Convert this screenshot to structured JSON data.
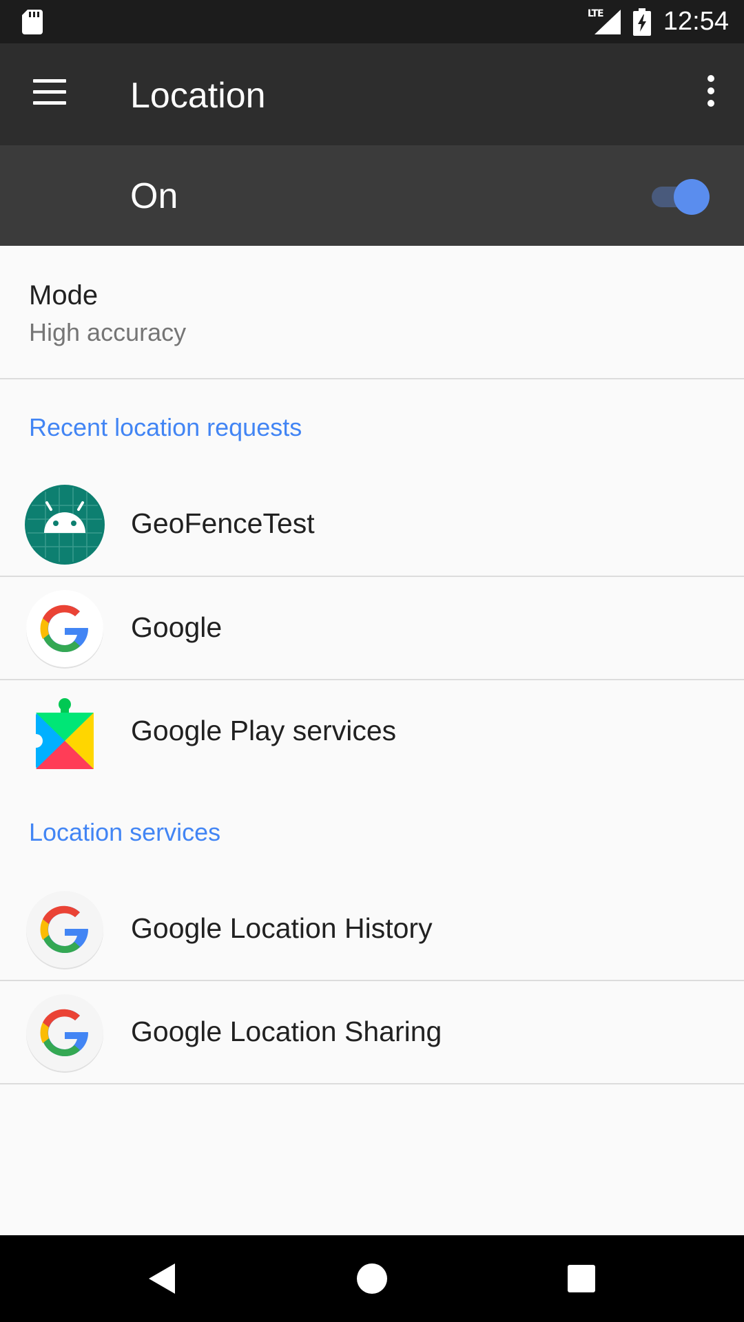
{
  "status_bar": {
    "network_type": "LTE",
    "time": "12:54"
  },
  "app_bar": {
    "title": "Location",
    "menu_icon": "hamburger-menu-icon",
    "overflow_icon": "more-vert-icon"
  },
  "master_switch": {
    "label": "On",
    "checked": true,
    "accent_color": "#5a8dee"
  },
  "mode": {
    "title": "Mode",
    "summary": "High accuracy"
  },
  "recent_requests": {
    "header": "Recent location requests",
    "header_color": "#4285f4",
    "items": [
      {
        "label": "GeoFenceTest",
        "icon": "android-app-icon"
      },
      {
        "label": "Google",
        "icon": "google-g-icon"
      },
      {
        "label": "Google Play services",
        "icon": "play-services-icon"
      }
    ]
  },
  "location_services": {
    "header": "Location services",
    "items": [
      {
        "label": "Google Location History",
        "icon": "google-g-icon"
      },
      {
        "label": "Google Location Sharing",
        "icon": "google-g-icon"
      }
    ]
  },
  "nav_bar": {
    "back_icon": "back-triangle-icon",
    "home_icon": "home-circle-icon",
    "recents_icon": "recents-square-icon"
  }
}
